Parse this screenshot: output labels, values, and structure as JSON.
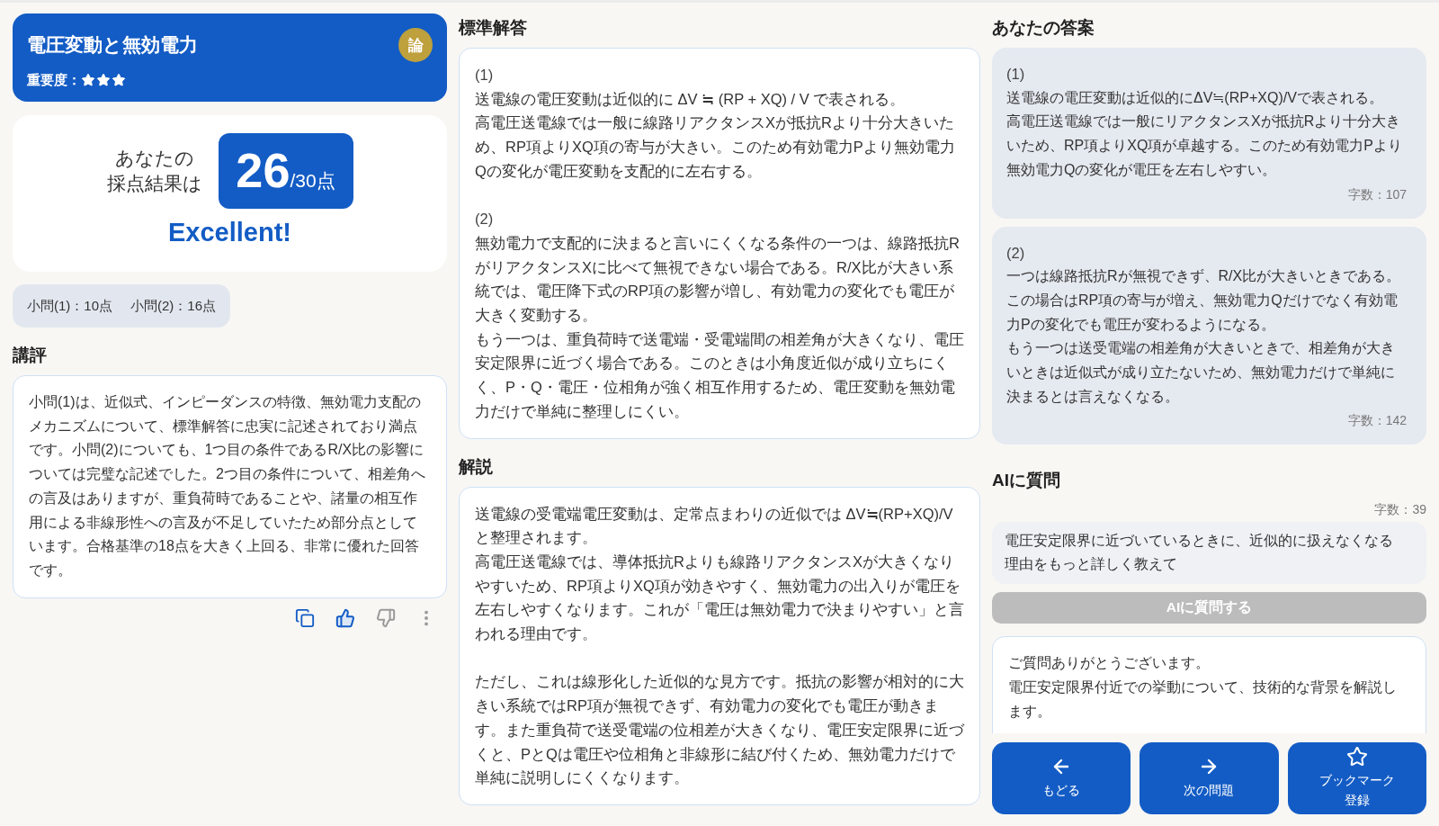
{
  "problem": {
    "title": "電圧変動と無効電力",
    "importance_label": "重要度：",
    "stars": 3,
    "category": "論"
  },
  "result": {
    "intro_lines": [
      "あなたの",
      "採点結果は"
    ],
    "score": "26",
    "max": "/30点",
    "verdict": "Excellent!"
  },
  "sub_scores": [
    "小問(1)：10点",
    "小問(2)：16点"
  ],
  "review": {
    "heading": "講評",
    "text": "小問(1)は、近似式、インピーダンスの特徴、無効電力支配のメカニズムについて、標準解答に忠実に記述されており満点です。小問(2)についても、1つ目の条件であるR/X比の影響については完璧な記述でした。2つ目の条件について、相差角への言及はありますが、重負荷時であることや、諸量の相互作用による非線形性への言及が不足していたため部分点としています。合格基準の18点を大きく上回る、非常に優れた回答です。",
    "feedback": {
      "liked": true,
      "disliked": false
    }
  },
  "model_answer": {
    "heading": "標準解答",
    "parts": [
      {
        "label": "(1)",
        "paragraphs": [
          "送電線の電圧変動は近似的に ΔV ≒ (RP + XQ) / V で表される。",
          "高電圧送電線では一般に線路リアクタンスXが抵抗Rより十分大きいため、RP項よりXQ項の寄与が大きい。このため有効電力Pより無効電力Qの変化が電圧変動を支配的に左右する。"
        ]
      },
      {
        "label": "(2)",
        "paragraphs": [
          "無効電力で支配的に決まると言いにくくなる条件の一つは、線路抵抗RがリアクタンスXに比べて無視できない場合である。R/X比が大きい系統では、電圧降下式のRP項の影響が増し、有効電力の変化でも電圧が大きく変動する。",
          "もう一つは、重負荷時で送電端・受電端間の相差角が大きくなり、電圧安定限界に近づく場合である。このときは小角度近似が成り立ちにくく、P・Q・電圧・位相角が強く相互作用するため、電圧変動を無効電力だけで単純に整理しにくい。"
        ]
      }
    ]
  },
  "explanation": {
    "heading": "解説",
    "blocks": [
      [
        "送電線の受電端電圧変動は、定常点まわりの近似では ΔV≒(RP+XQ)/V と整理されます。",
        "高電圧送電線では、導体抵抗Rよりも線路リアクタンスXが大きくなりやすいため、RP項よりXQ項が効きやすく、無効電力の出入りが電圧を左右しやすくなります。これが「電圧は無効電力で決まりやすい」と言われる理由です。"
      ],
      [
        "ただし、これは線形化した近似的な見方です。抵抗の影響が相対的に大きい系統ではRP項が無視できず、有効電力の変化でも電圧が動きます。また重負荷で送受電端の位相差が大きくなり、電圧安定限界に近づくと、PとQは電圧や位相角と非線形に結び付くため、無効電力だけで単純に説明しにくくなります。"
      ]
    ]
  },
  "your_answer": {
    "heading": "あなたの答案",
    "parts": [
      {
        "label": "(1)",
        "paragraphs": [
          "送電線の電圧変動は近似的にΔV≒(RP+XQ)/Vで表される。",
          "高電圧送電線では一般にリアクタンスXが抵抗Rより十分大きいため、RP項よりXQ項が卓越する。このため有効電力Pより無効電力Qの変化が電圧を左右しやすい。"
        ],
        "count": "字数：107"
      },
      {
        "label": "(2)",
        "paragraphs": [
          "一つは線路抵抗Rが無視できず、R/X比が大きいときである。この場合はRP項の寄与が増え、無効電力Qだけでなく有効電力Pの変化でも電圧が変わるようになる。",
          "もう一つは送受電端の相差角が大きいときで、相差角が大きいときは近似式が成り立たないため、無効電力だけで単純に決まるとは言えなくなる。"
        ],
        "count": "字数：142"
      }
    ]
  },
  "ask_ai": {
    "heading": "AIに質問",
    "count": "字数：39",
    "question": "電圧安定限界に近づいているときに、近似的に扱えなくなる理由をもっと詳しく教えて",
    "button": {
      "label": "AIに質問する",
      "disabled": true
    },
    "response": [
      "ご質問ありがとうございます。",
      "電圧安定限界付近での挙動について、技術的な背景を解説します。"
    ]
  },
  "nav": [
    {
      "kind": "back",
      "label": "もどる"
    },
    {
      "kind": "next",
      "label": "次の問題"
    },
    {
      "kind": "bookmark",
      "label": "ブックマーク登録",
      "on": false
    }
  ]
}
